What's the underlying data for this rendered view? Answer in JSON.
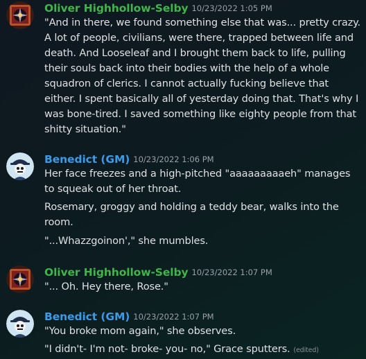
{
  "messages": [
    {
      "author": "Oliver Highhollow-Selby",
      "timestamp": "10/23/2022 1:05 PM",
      "lines": [
        "\"And in there, we found something else that was... pretty crazy. A lot of people, civilians, were there, trapped between life and death. And Looseleaf and I brought them back to life, pulling their souls back into their bodies with the help of a whole squadron of clerics. I cannot actually fucking believe that either. I spent basically all of yesterday doing that. That's why I was bone-tired. I saved something like eighty people from that shitty situation.\""
      ]
    },
    {
      "author": "Benedict (GM)",
      "timestamp": "10/23/2022 1:06 PM",
      "lines": [
        "Her face freezes and a high-pitched \"aaaaaaaaaeh\" manages to squeak out of her throat.",
        "Rosemary, groggy and holding a teddy bear, walks into the room.",
        "\"...Whazzgoinon',\" she mumbles."
      ]
    },
    {
      "author": "Oliver Highhollow-Selby",
      "timestamp": "10/23/2022 1:07 PM",
      "lines": [
        "\"... Oh. Hey there, Rose.\""
      ]
    },
    {
      "author": "Benedict (GM)",
      "timestamp": "10/23/2022 1:07 PM",
      "lines": [
        "\"You broke mom again,\" she observes.",
        "\"I didn't- I'm not- broke- you- no,\" Grace sputters."
      ],
      "edited": "(edited)"
    }
  ],
  "colors": {
    "oliver_name": "#3fb54a",
    "gm_name": "#3b9be8",
    "background": "#0c1c20"
  },
  "icons": {
    "oliver_avatar": "crimson-emblem-avatar",
    "gm_avatar": "skeleton-cowboy-avatar"
  }
}
